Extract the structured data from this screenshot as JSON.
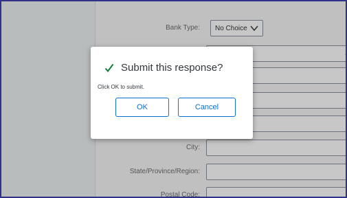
{
  "form": {
    "bank_type_label": "Bank Type:",
    "bank_type_value": "No Choice",
    "city_label": "City:",
    "state_label": "State/Province/Region:",
    "postal_label": "Postal Code:"
  },
  "dialog": {
    "title": "Submit this response?",
    "message": "Click OK to submit.",
    "ok_label": "OK",
    "cancel_label": "Cancel"
  },
  "colors": {
    "accent": "#0a6ed1",
    "success": "#107e3e",
    "frame_border": "#3f3fb0"
  }
}
